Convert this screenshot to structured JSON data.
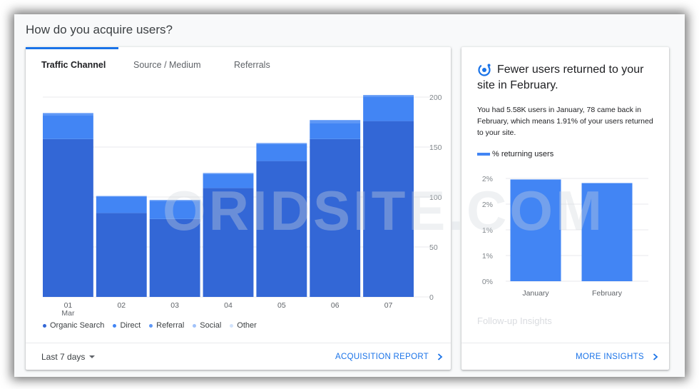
{
  "page": {
    "title": "How do you acquire users?"
  },
  "acquisition_card": {
    "tabs": [
      {
        "label": "Traffic Channel",
        "active": true
      },
      {
        "label": "Source / Medium",
        "active": false
      },
      {
        "label": "Referrals",
        "active": false
      }
    ],
    "footer": {
      "range_label": "Last 7 days",
      "report_link": "ACQUISITION REPORT"
    }
  },
  "insight_card": {
    "icon": "insights-icon",
    "title": "Fewer users returned to your site in February.",
    "body": "You had 5.58K users in January, 78 came back in February, which means 1.91% of your users returned to your site.",
    "legend_label": "% returning users",
    "followup": "Follow-up Insights",
    "footer_link": "MORE INSIGHTS"
  },
  "watermark": "ORIDSITE.COM",
  "colors": {
    "accent": "#1a73e8",
    "organic": "#3367d6",
    "direct": "#4285f4",
    "referral": "#5e97f6",
    "social": "#a1c2fa",
    "other": "#d2e3fc"
  },
  "chart_data": [
    {
      "type": "bar",
      "stacked": true,
      "categories": [
        "01",
        "02",
        "03",
        "04",
        "05",
        "06",
        "07"
      ],
      "category_sublabels": [
        "Mar",
        "",
        "",
        "",
        "",
        "",
        ""
      ],
      "series": [
        {
          "name": "Organic Search",
          "values": [
            158,
            84,
            78,
            109,
            136,
            158,
            176
          ]
        },
        {
          "name": "Direct",
          "values": [
            24,
            16,
            18,
            14,
            17,
            16,
            24
          ]
        },
        {
          "name": "Referral",
          "values": [
            2,
            1,
            1,
            1,
            1,
            3,
            2
          ]
        },
        {
          "name": "Social",
          "values": [
            0,
            0,
            0,
            0,
            0,
            0,
            0
          ]
        },
        {
          "name": "Other",
          "values": [
            0,
            0,
            0,
            0,
            0,
            0,
            0
          ]
        }
      ],
      "ylim": [
        0,
        200
      ],
      "yticks": [
        0,
        50,
        100,
        150,
        200
      ],
      "ytick_labels": [
        "0",
        "50",
        "100",
        "150",
        "200"
      ],
      "grid": true,
      "legend_position": "bottom-left"
    },
    {
      "type": "bar",
      "categories": [
        "January",
        "February"
      ],
      "series": [
        {
          "name": "% returning users",
          "values": [
            1.98,
            1.91
          ]
        }
      ],
      "ylim": [
        0,
        2
      ],
      "yticks": [
        0,
        0.5,
        1,
        1.5,
        2
      ],
      "ytick_labels": [
        "0%",
        "1%",
        "1%",
        "2%",
        "2%"
      ],
      "grid": true
    }
  ]
}
